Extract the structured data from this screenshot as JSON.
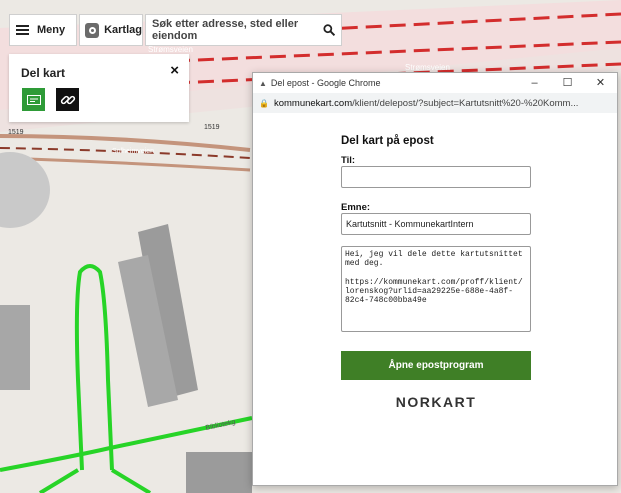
{
  "map": {
    "street_labels": [
      "Strømsveien",
      "Strømsveien",
      "Solheimveien",
      "1519",
      "1519",
      "Bibliotekg"
    ]
  },
  "toolbar": {
    "menu_label": "Meny",
    "layers_label": "Kartlag",
    "search_placeholder": "Søk etter adresse, sted eller eiendom"
  },
  "share_panel": {
    "title": "Del kart",
    "close": "×"
  },
  "chrome_window": {
    "title": "Del epost - Google Chrome",
    "minimize": "–",
    "maximize": "☐",
    "close": "✕",
    "url_host": "kommunekart.com",
    "url_path": "/klient/delepost/?subject=Kartutsnitt%20-%20Komm..."
  },
  "form": {
    "heading": "Del kart på epost",
    "to_label": "Til:",
    "to_value": "",
    "subject_label": "Emne:",
    "subject_value": "Kartutsnitt - KommunekartIntern",
    "message": "Hei, jeg vil dele dette kartutsnittet med deg.\n\nhttps://kommunekart.com/proff/klient/lorenskog?urlid=aa29225e-688e-4a8f-82c4-748c00bba49e",
    "button_label": "Åpne epostprogram",
    "logo": "NORKART"
  }
}
